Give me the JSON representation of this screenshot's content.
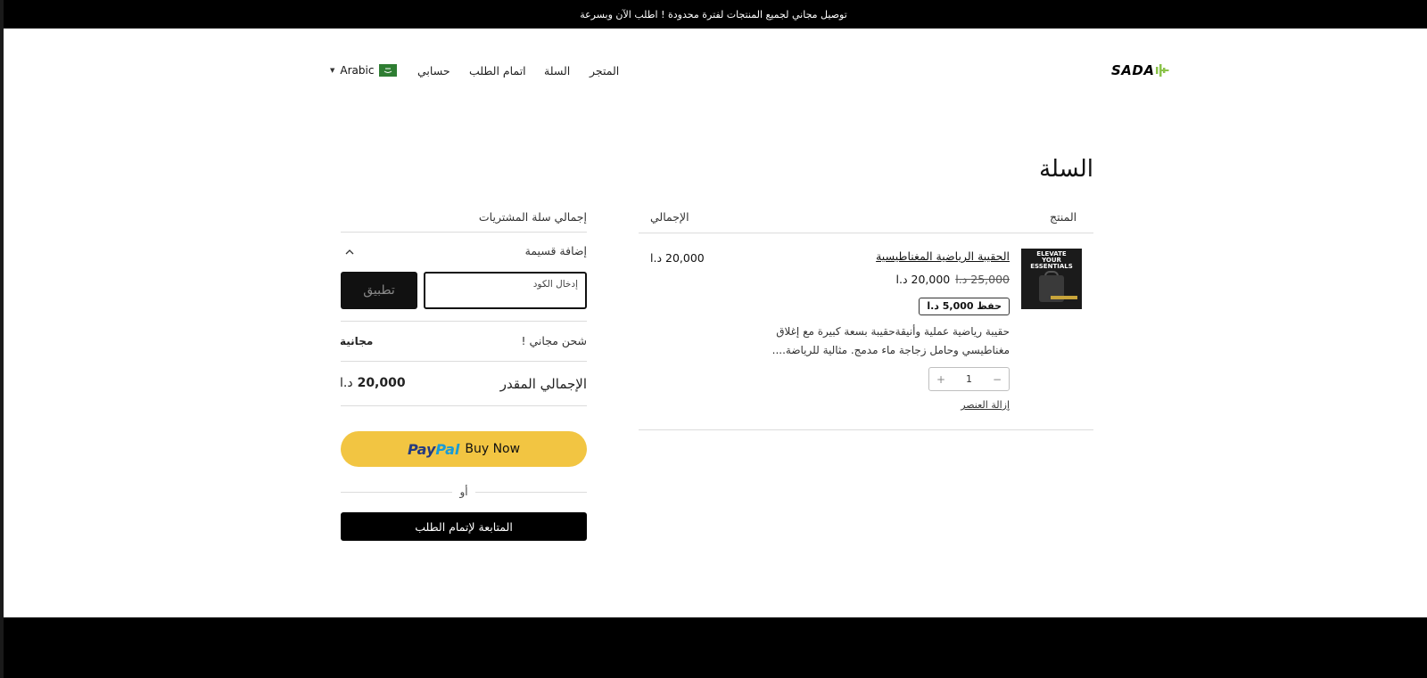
{
  "announcement": "توصيل مجاني لجميع المنتجات لفترة محدودة ! اطلب الآن وبسرعة",
  "header": {
    "logo_text": "SADA",
    "nav": {
      "store": "المتجر",
      "cart": "السلة",
      "checkout": "اتمام الطلب",
      "account": "حسابي"
    },
    "language": "Arabic"
  },
  "cart": {
    "title": "السلة",
    "columns": {
      "product": "المنتج",
      "total": "الإجمالي"
    },
    "item": {
      "image_text": [
        "ELEVATE",
        "YOUR",
        "ESSENTIALS"
      ],
      "name": "الحقيبة الرياضية المغناطيسية",
      "old_price": "25,000 د.ا",
      "price": "20,000 د.ا",
      "save_badge": "حفظ 5,000 د.ا",
      "description": "حقيبة رياضية عملية وأنيقةحقيبة بسعة كبيرة مع إغلاق مغناطيسي وحامل زجاجة ماء مدمج. مثالية للرياضة....",
      "quantity": "1",
      "minus": "−",
      "plus": "+",
      "remove": "إزالة العنصر",
      "line_total": "20,000 د.ا"
    }
  },
  "summary": {
    "title": "إجمالي سلة المشتريات",
    "coupon_label": "إضافة قسيمة",
    "coupon_placeholder": "إدخال الكود",
    "apply": "تطبيق",
    "shipping_label": "شحن مجاني !",
    "shipping_value": "مجانية",
    "estimated_label": "الإجمالي المقدر",
    "estimated_amount": "20,000",
    "estimated_currency": "د.ا",
    "paypal_pay": "Pay",
    "paypal_pal": "Pal",
    "paypal_buy": "Buy Now",
    "or": "أو",
    "checkout_button": "المتابعة لإتمام الطلب"
  },
  "colors": {
    "paypal_yellow": "#f2c542",
    "logo_accent": "#8bc34a",
    "black": "#000000"
  }
}
